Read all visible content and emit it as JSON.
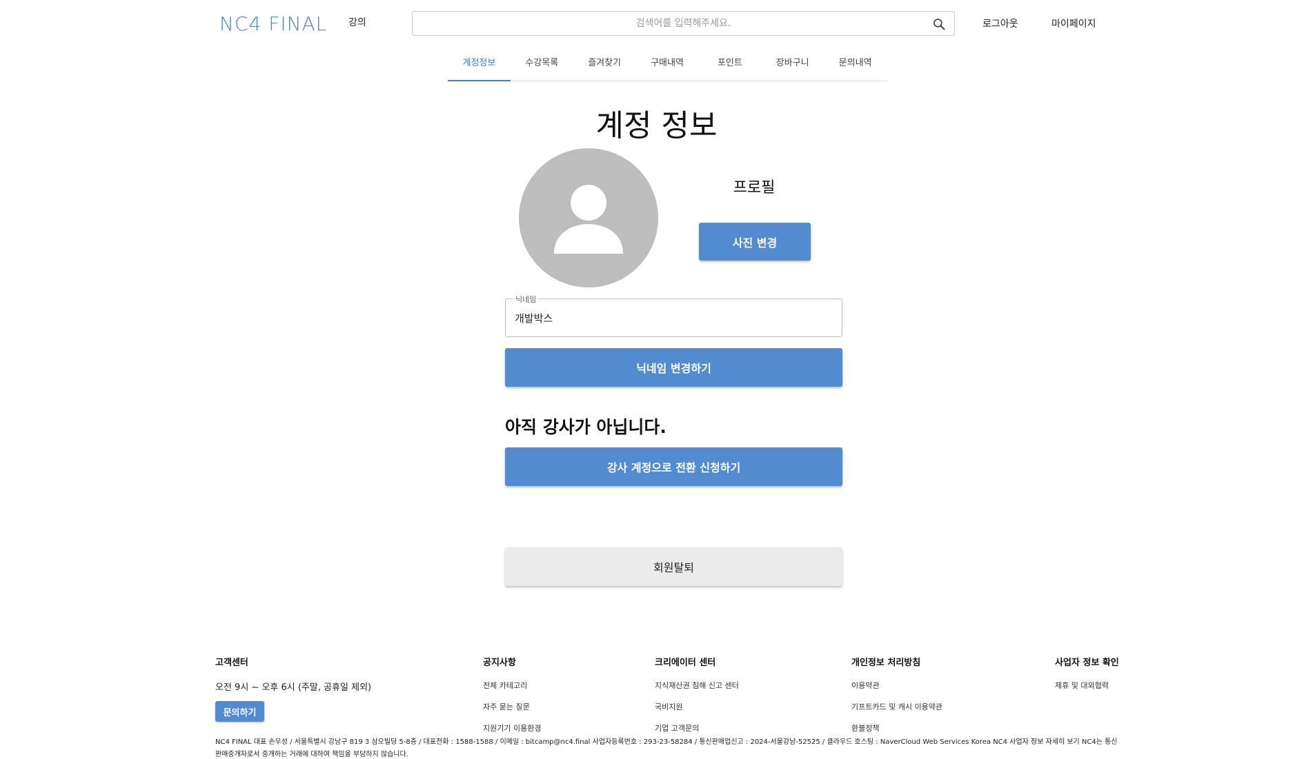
{
  "header": {
    "logo": "NC4 FINAL",
    "nav_course": "강의",
    "search_placeholder": "검색어를 입력해주세요.",
    "logout": "로그아웃",
    "mypage": "마이페이지"
  },
  "tabs": [
    {
      "label": "계정정보",
      "active": true
    },
    {
      "label": "수강목록",
      "active": false
    },
    {
      "label": "즐겨찾기",
      "active": false
    },
    {
      "label": "구매내역",
      "active": false
    },
    {
      "label": "포인트",
      "active": false
    },
    {
      "label": "장바구니",
      "active": false
    },
    {
      "label": "문의내역",
      "active": false
    }
  ],
  "main": {
    "title": "계정 정보",
    "profile_label": "프로필",
    "change_photo": "사진 변경",
    "nickname_label": "닉네임",
    "nickname_value": "개발박스",
    "change_nickname": "닉네임 변경하기",
    "instructor_status": "아직 강사가 아닙니다.",
    "apply_instructor": "강사 계정으로 전환 신청하기",
    "withdraw": "회원탈퇴"
  },
  "footer": {
    "support": {
      "title": "고객센터",
      "hours": "오전 9시 ~ 오후 6시 (주말, 공휴일 제외)",
      "inquiry_button": "문의하기"
    },
    "notice": {
      "title": "공지사항",
      "links": [
        "전체 카테고리",
        "자주 묻는 질문",
        "지원기기 이용환경"
      ]
    },
    "creator": {
      "title": "크리에이터 센터",
      "links": [
        "지식재산권 침해 신고 센터",
        "국비지원",
        "기업 고객문의"
      ]
    },
    "privacy": {
      "title": "개인정보 처리방침",
      "links": [
        "이용약관",
        "기프트카드 및 캐시 이용약관",
        "환불정책"
      ]
    },
    "business": {
      "title": "사업자 정보 확인",
      "links": [
        "제휴 및 대외협력"
      ]
    },
    "company_info": "NC4 FINAL 대표 손우성 / 서울특별시 강남구 819 3 삼오빌딩 5-8층 / 대표전화 : 1588-1588 / 이메일 : bitcamp@nc4.final 사업자등록번호 : 293-23-58284 / 통신판매업신고 : 2024-서울강남-52525 / 클라우드 호스팅 : NaverCloud Web Services Korea NC4 사업자 정보 자세히 보기 NC4는 통신판매중개자로서 중개하는 거래에 대하여 책임을 부담하지 않습니다."
  },
  "colors": {
    "accent": "#538bd1",
    "logo": "#4a86c8",
    "avatar_bg": "#bdbdbd",
    "withdraw_bg": "#ebebeb"
  }
}
